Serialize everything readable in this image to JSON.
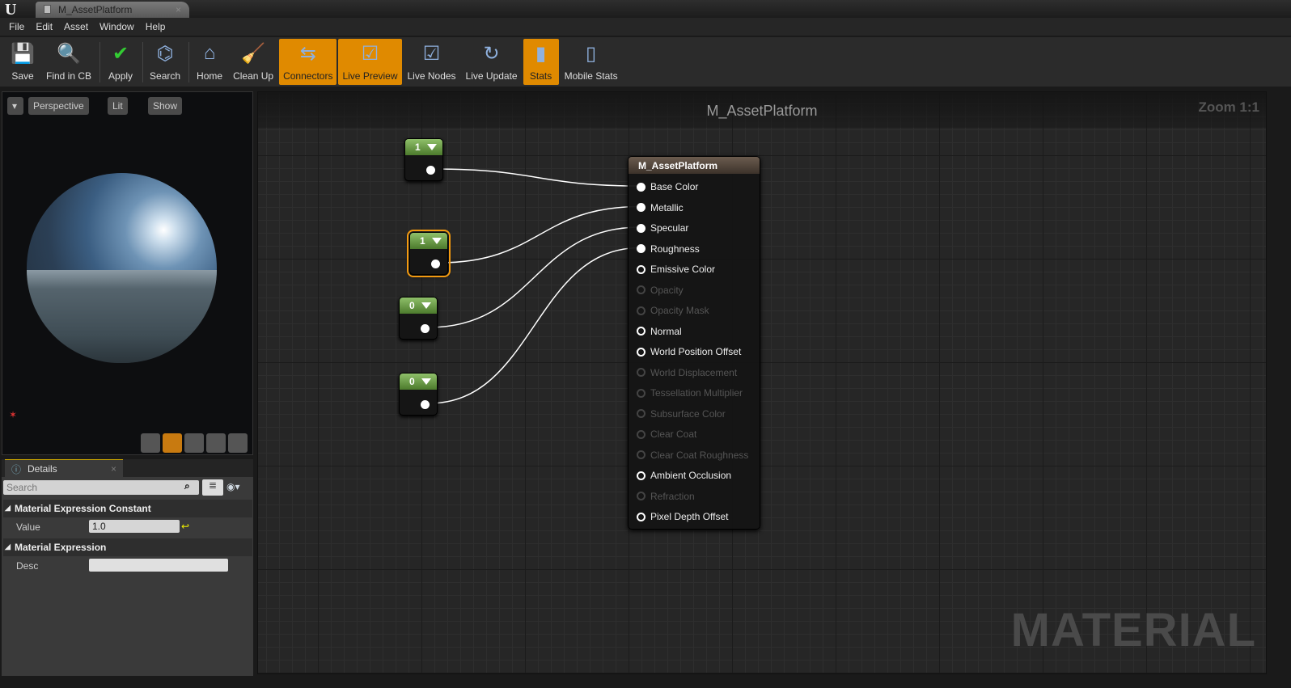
{
  "window": {
    "tab_title": "M_AssetPlatform"
  },
  "menu": [
    "File",
    "Edit",
    "Asset",
    "Window",
    "Help"
  ],
  "toolbar": [
    {
      "label": "Save",
      "icon": "save-icon",
      "active": false
    },
    {
      "label": "Find in CB",
      "icon": "magnifier-icon",
      "active": false
    },
    {
      "label": "Apply",
      "icon": "checkmark-icon",
      "active": false
    },
    {
      "label": "Search",
      "icon": "binoculars-icon",
      "active": false
    },
    {
      "label": "Home",
      "icon": "home-icon",
      "active": false
    },
    {
      "label": "Clean Up",
      "icon": "broom-icon",
      "active": false
    },
    {
      "label": "Connectors",
      "icon": "connectors-icon",
      "active": true
    },
    {
      "label": "Live Preview",
      "icon": "tv-check-icon",
      "active": true
    },
    {
      "label": "Live Nodes",
      "icon": "live-nodes-icon",
      "active": false
    },
    {
      "label": "Live Update",
      "icon": "live-update-icon",
      "active": false
    },
    {
      "label": "Stats",
      "icon": "bar-stats-icon",
      "active": true
    },
    {
      "label": "Mobile Stats",
      "icon": "mobile-stats-icon",
      "active": false
    }
  ],
  "viewport": {
    "perspective": "Perspective",
    "lit": "Lit",
    "show": "Show"
  },
  "details": {
    "tab": "Details",
    "search_placeholder": "Search",
    "sections": [
      {
        "title": "Material Expression Constant",
        "row_label": "Value",
        "row_value": "1.0"
      },
      {
        "title": "Material Expression",
        "row_label": "Desc",
        "row_value": ""
      }
    ]
  },
  "graph": {
    "title": "M_AssetPlatform",
    "zoom": "Zoom 1:1",
    "watermark": "MATERIAL",
    "constants": [
      {
        "value": "1",
        "selected": false
      },
      {
        "value": "1",
        "selected": true
      },
      {
        "value": "0",
        "selected": false
      },
      {
        "value": "0",
        "selected": false
      }
    ],
    "material_node": {
      "title": "M_AssetPlatform",
      "inputs": [
        {
          "label": "Base Color",
          "state": "connected"
        },
        {
          "label": "Metallic",
          "state": "connected"
        },
        {
          "label": "Specular",
          "state": "connected"
        },
        {
          "label": "Roughness",
          "state": "connected"
        },
        {
          "label": "Emissive Color",
          "state": "open"
        },
        {
          "label": "Opacity",
          "state": "disabled"
        },
        {
          "label": "Opacity Mask",
          "state": "disabled"
        },
        {
          "label": "Normal",
          "state": "open"
        },
        {
          "label": "World Position Offset",
          "state": "open"
        },
        {
          "label": "World Displacement",
          "state": "disabled"
        },
        {
          "label": "Tessellation Multiplier",
          "state": "disabled"
        },
        {
          "label": "Subsurface Color",
          "state": "disabled"
        },
        {
          "label": "Clear Coat",
          "state": "disabled"
        },
        {
          "label": "Clear Coat Roughness",
          "state": "disabled"
        },
        {
          "label": "Ambient Occlusion",
          "state": "open"
        },
        {
          "label": "Refraction",
          "state": "disabled"
        },
        {
          "label": "Pixel Depth Offset",
          "state": "open"
        }
      ]
    },
    "connections": [
      {
        "from": 0,
        "to": "Base Color"
      },
      {
        "from": 1,
        "to": "Metallic"
      },
      {
        "from": 2,
        "to": "Specular"
      },
      {
        "from": 3,
        "to": "Roughness"
      }
    ]
  },
  "colors": {
    "accent": "#e08a00",
    "constant_header": "#6a9a45",
    "selection": "#f39a10"
  }
}
